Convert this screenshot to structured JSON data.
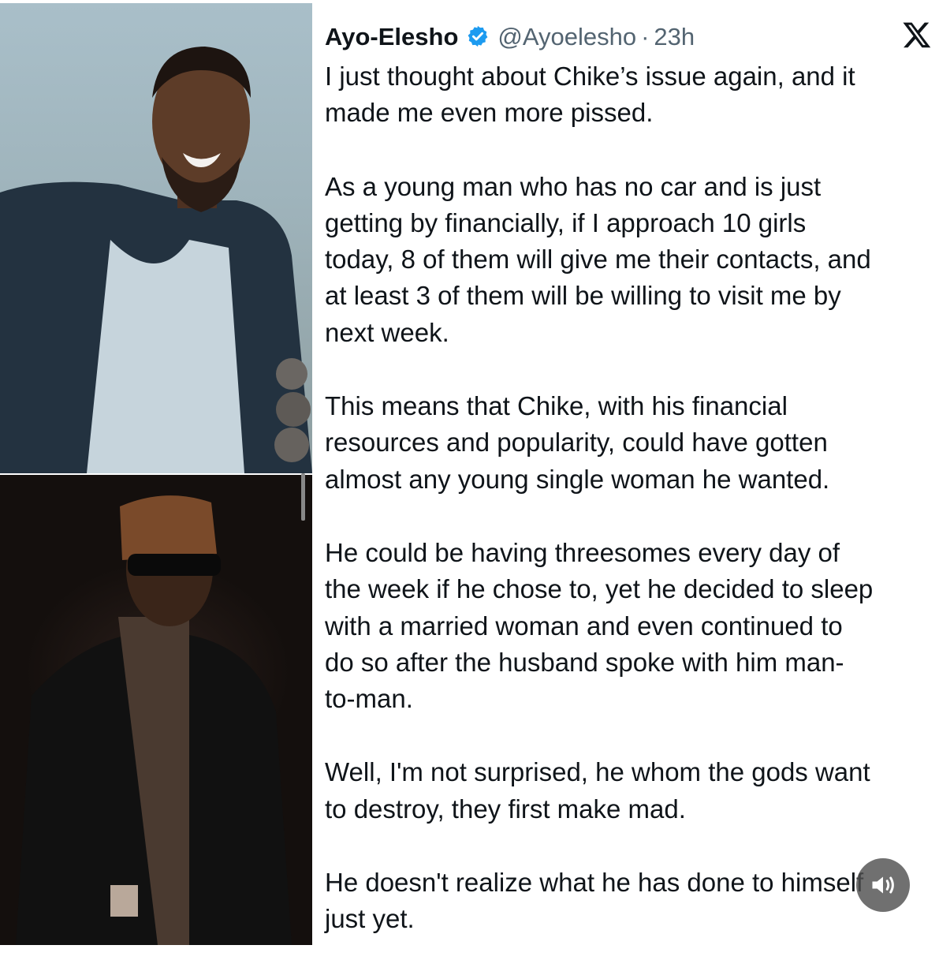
{
  "tweet": {
    "author_name": "Ayo-Elesho",
    "handle": "@Ayoelesho",
    "separator": "·",
    "time": "23h",
    "paragraphs": [
      [
        "I just thought about Chike’s issue again, and it",
        "made me even more pissed."
      ],
      [
        "As a young man who has no car and is just",
        "getting by financially, if I approach 10 girls",
        "today, 8 of them will give me their contacts, and",
        "at least 3 of them will be willing to visit me by",
        "next week."
      ],
      [
        "This means that Chike, with his financial",
        "resources and popularity, could have gotten",
        "almost any young single woman he wanted."
      ],
      [
        "He could be having threesomes every day of",
        "the week if he chose to, yet he decided to sleep",
        "with a married woman and even continued to",
        "do so after the husband spoke with him man-",
        "to-man."
      ],
      [
        "Well, I'm not surprised, he whom the gods want",
        "to destroy, they first make mad."
      ],
      [
        "He doesn't realize what he has done to himself",
        "just yet."
      ]
    ]
  },
  "icons": {
    "verified": "verified-badge-icon",
    "platform": "x-logo-icon",
    "audio": "speaker-icon"
  },
  "colors": {
    "verified_blue": "#1d9bf0",
    "text": "#0f1419",
    "secondary": "#536471"
  }
}
